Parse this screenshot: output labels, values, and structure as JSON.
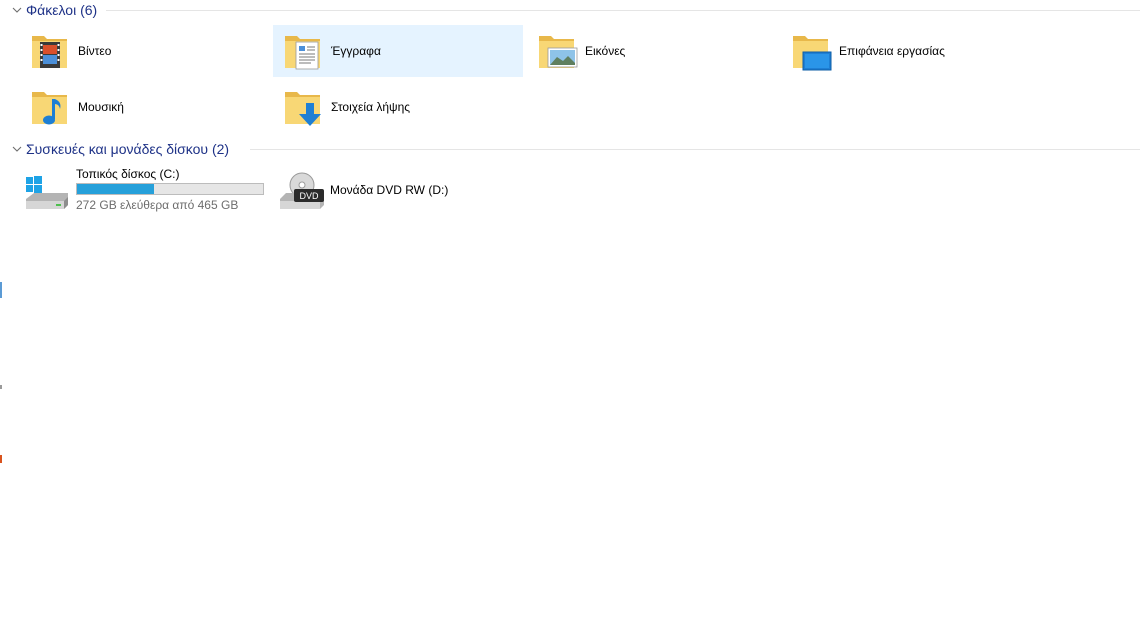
{
  "colors": {
    "group_header": "#1e3287",
    "selection": "#e5f3ff",
    "usage_bar": "#26a0da",
    "secondary_text": "#6d6d6d"
  },
  "folders_group": {
    "title": "Φάκελοι (6)",
    "items": [
      {
        "label": "Βίντεο",
        "icon": "videos-folder-icon",
        "selected": false
      },
      {
        "label": "Έγγραφα",
        "icon": "documents-folder-icon",
        "selected": true
      },
      {
        "label": "Εικόνες",
        "icon": "pictures-folder-icon",
        "selected": false
      },
      {
        "label": "Επιφάνεια εργασίας",
        "icon": "desktop-folder-icon",
        "selected": false
      },
      {
        "label": "Μουσική",
        "icon": "music-folder-icon",
        "selected": false
      },
      {
        "label": "Στοιχεία λήψης",
        "icon": "downloads-folder-icon",
        "selected": false
      }
    ]
  },
  "devices_group": {
    "title": "Συσκευές και μονάδες δίσκου (2)",
    "drives": [
      {
        "name": "Τοπικός δίσκος (C:)",
        "free_text": "272 GB ελεύθερα από 465 GB",
        "used_fraction": 0.415,
        "icon": "local-disk-icon"
      },
      {
        "name": "Μονάδα DVD RW (D:)",
        "icon": "dvd-drive-icon"
      }
    ]
  }
}
